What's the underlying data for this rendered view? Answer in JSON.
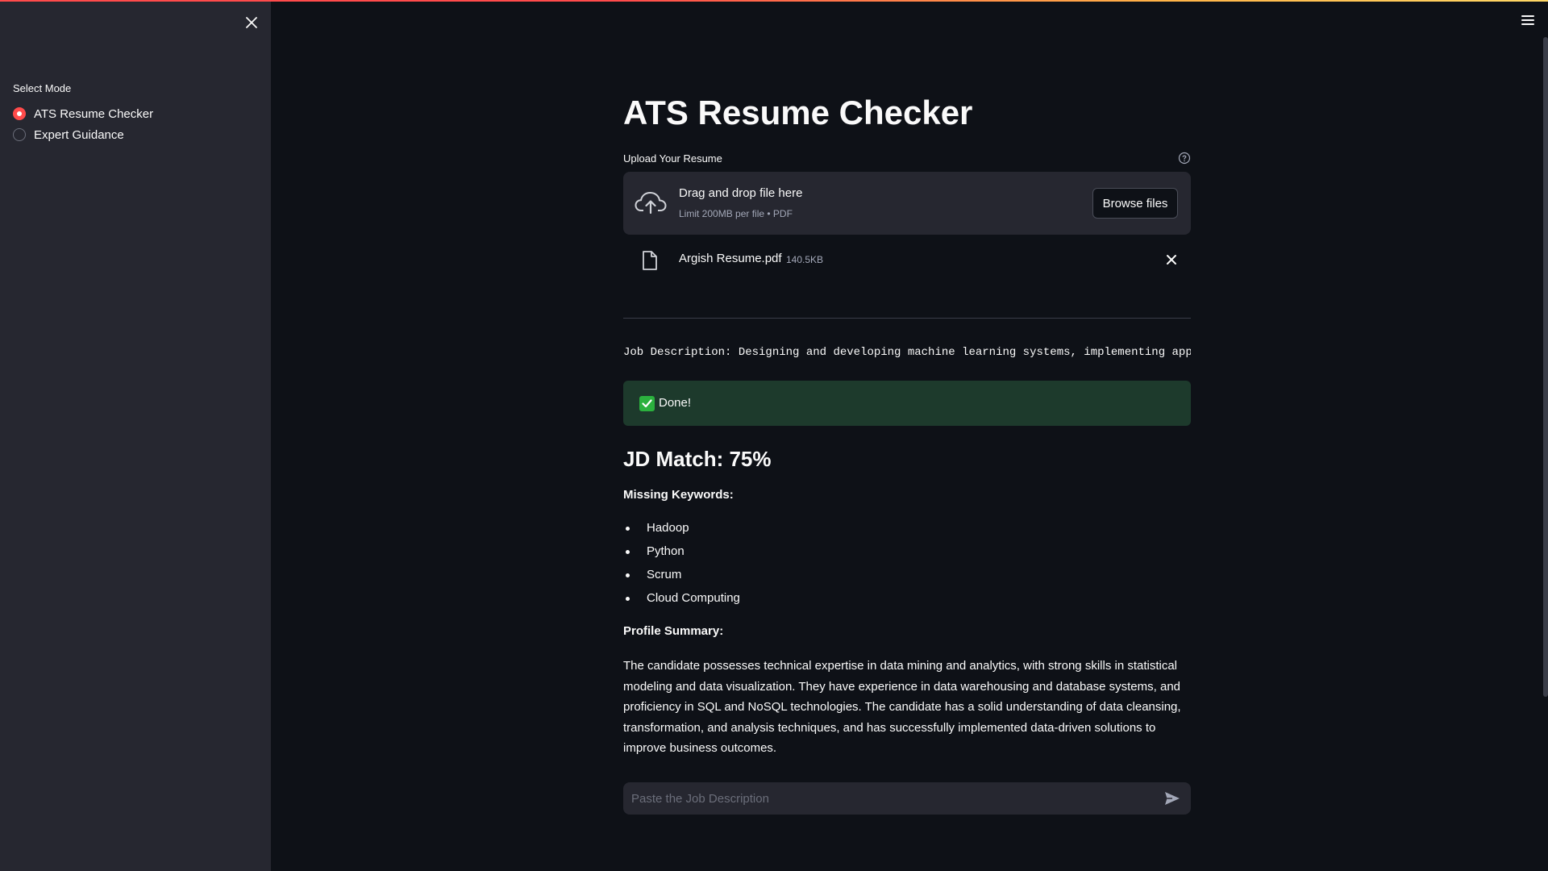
{
  "sidebar": {
    "mode_label": "Select Mode",
    "modes": [
      {
        "label": "ATS Resume Checker",
        "selected": true
      },
      {
        "label": "Expert Guidance",
        "selected": false
      }
    ]
  },
  "main": {
    "title": "ATS Resume Checker",
    "upload": {
      "label": "Upload Your Resume",
      "drop_title": "Drag and drop file here",
      "drop_subtitle": "Limit 200MB per file • PDF",
      "browse_label": "Browse files",
      "file_name": "Argish Resume.pdf",
      "file_size": "140.5KB"
    },
    "job_description_line": "Job Description: Designing and developing machine learning systems, implementing appropriate ML algorithms, conducting experiments",
    "status": {
      "text": "Done!",
      "color": "#1d3a2c"
    },
    "match": "JD Match: 75%",
    "missing_label": "Missing Keywords:",
    "missing_keywords": [
      "Hadoop",
      "Python",
      "Scrum",
      "Cloud Computing"
    ],
    "summary_label": "Profile Summary:",
    "summary": "The candidate possesses technical expertise in data mining and analytics, with strong skills in statistical modeling and data visualization. They have experience in data warehousing and database systems, and proficiency in SQL and NoSQL technologies. The candidate has a solid understanding of data cleansing, transformation, and analysis techniques, and has successfully implemented data-driven solutions to improve business outcomes.",
    "chat_placeholder": "Paste the Job Description"
  },
  "icons": {
    "close": "close-icon",
    "menu": "hamburger-menu-icon",
    "help": "help-icon",
    "cloud": "cloud-upload-icon",
    "file": "file-icon",
    "check": "check-icon",
    "send": "send-icon"
  },
  "colors": {
    "accent": "#ff4b4b",
    "background": "#0e1117",
    "sidebar": "#262730",
    "success": "#2bb13e"
  }
}
